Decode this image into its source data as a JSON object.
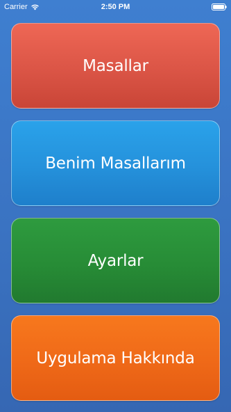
{
  "status_bar": {
    "carrier": "Carrier",
    "time": "2:50 PM",
    "wifi_icon": "wifi-icon",
    "battery_icon": "battery-icon"
  },
  "menu": {
    "tales": "Masallar",
    "my_tales": "Benim Masallarım",
    "settings": "Ayarlar",
    "about": "Uygulama Hakkında"
  },
  "colors": {
    "background": "#3a73c2",
    "tales_button": "#e05a49",
    "my_tales_button": "#2591db",
    "settings_button": "#278c36",
    "about_button": "#ef6918"
  }
}
